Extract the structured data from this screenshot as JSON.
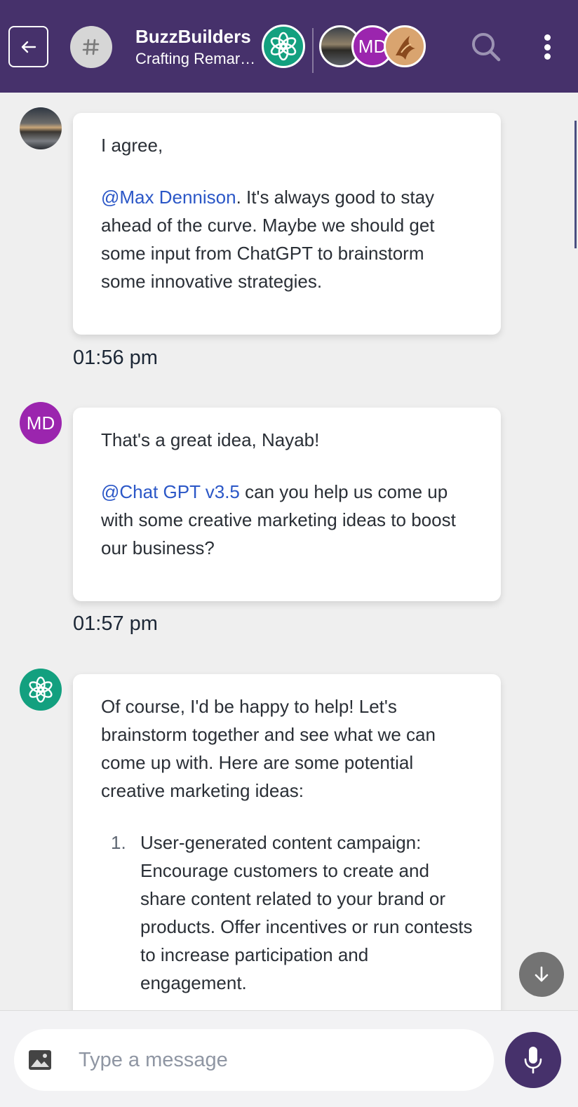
{
  "header": {
    "group_name": "BuzzBuilders",
    "group_subtitle": "Crafting Remarkable Experiences",
    "members": [
      {
        "type": "photo",
        "initials": ""
      },
      {
        "type": "initials",
        "initials": "MD"
      },
      {
        "type": "photo",
        "initials": ""
      }
    ],
    "accent_color": "#46316b"
  },
  "messages": [
    {
      "sender_avatar": "photo",
      "greeting": "I agree,",
      "mention": "@Max Dennison",
      "body": ". It's always good to stay ahead of the curve. Maybe we should get some input from ChatGPT to brainstorm some innovative strategies.",
      "time": "01:56 pm"
    },
    {
      "sender_avatar": "MD",
      "greeting": "That's a great idea, Nayab!",
      "mention": "@Chat GPT v3.5",
      "body": " can you help us come up with some creative marketing ideas to boost our business?",
      "time": "01:57 pm"
    },
    {
      "sender_avatar": "chatgpt-icon",
      "intro": "Of course, I'd be happy to help! Let's brainstorm together and see what we can come up with. Here are some potential creative marketing ideas:",
      "list": [
        {
          "num": "1.",
          "text": "User-generated content campaign: Encourage customers to create and share content related to your brand or products. Offer incentives or run contests to increase participation and engagement."
        }
      ]
    }
  ],
  "composer": {
    "placeholder": "Type a message"
  }
}
